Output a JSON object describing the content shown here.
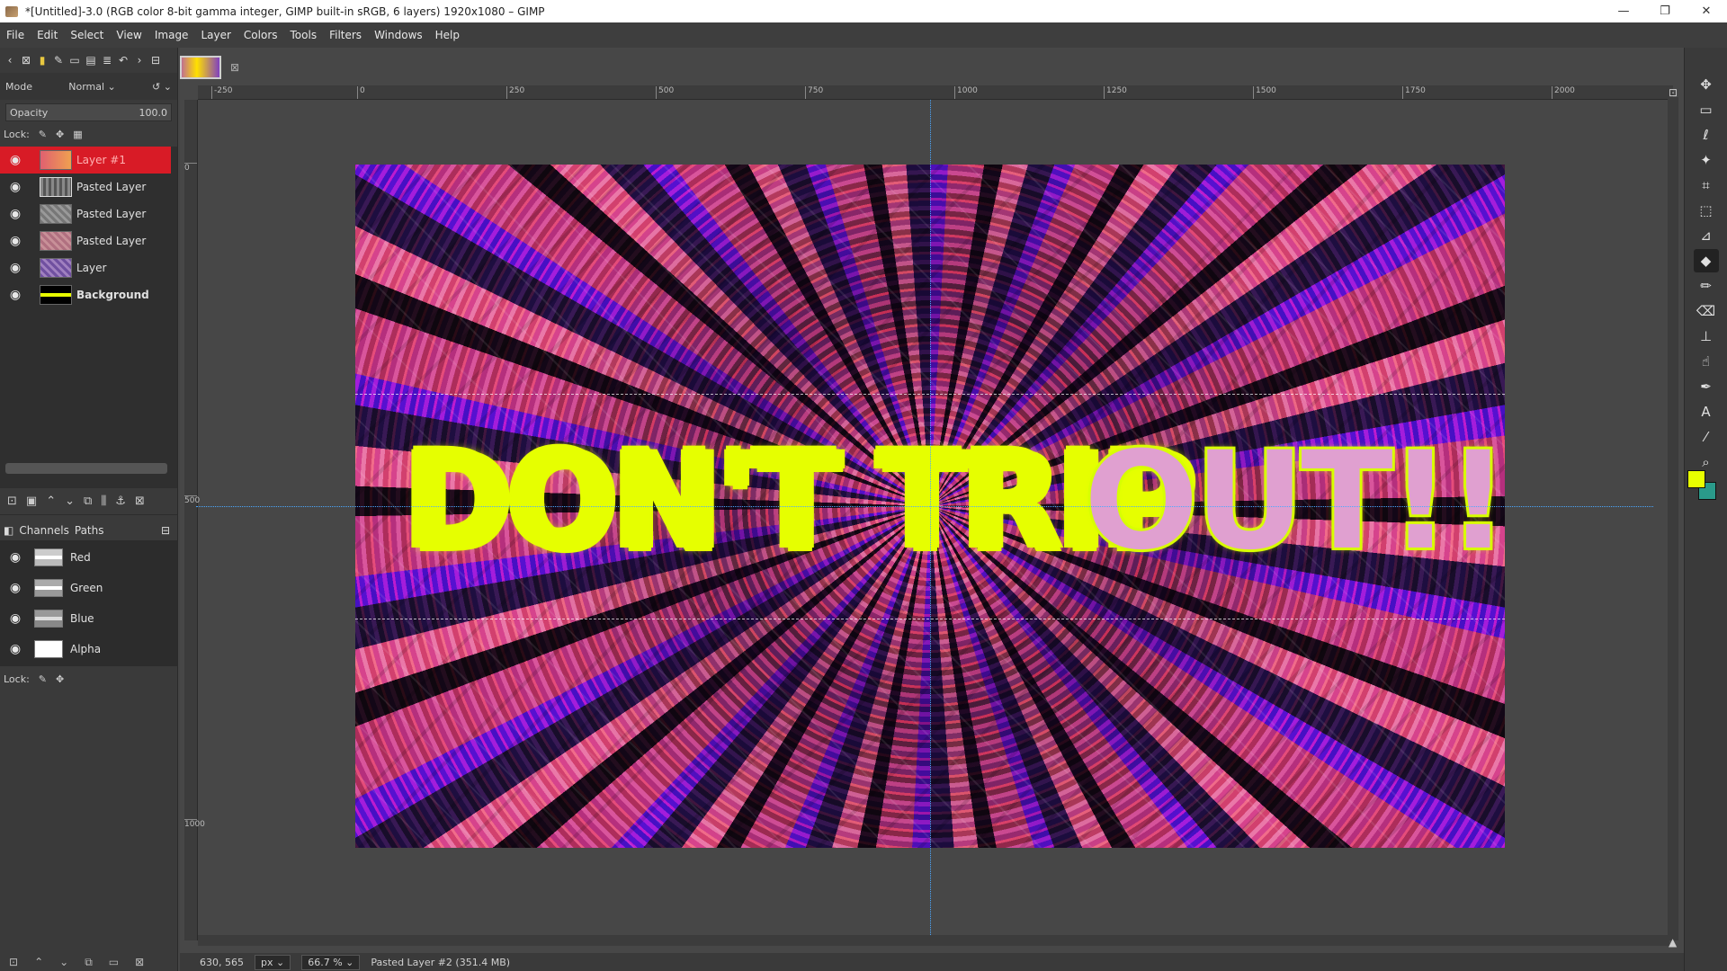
{
  "window": {
    "title": "*[Untitled]-3.0 (RGB color 8-bit gamma integer, GIMP built-in sRGB, 6 layers) 1920x1080 – GIMP",
    "minimize": "—",
    "maximize": "❐",
    "close": "✕"
  },
  "menu": [
    "File",
    "Edit",
    "Select",
    "View",
    "Image",
    "Layer",
    "Colors",
    "Tools",
    "Filters",
    "Windows",
    "Help"
  ],
  "layers_panel": {
    "mode_label": "Mode",
    "mode_value": "Normal",
    "opacity_label": "Opacity",
    "opacity_value": "100.0",
    "lock_label": "Lock:",
    "layers": [
      {
        "name": "Layer #1",
        "active": true
      },
      {
        "name": "Pasted Layer",
        "active": false
      },
      {
        "name": "Pasted Layer",
        "active": false
      },
      {
        "name": "Pasted Layer",
        "active": false
      },
      {
        "name": "Layer",
        "active": false
      },
      {
        "name": "Background",
        "active": false
      }
    ]
  },
  "channels_panel": {
    "tab_channels": "Channels",
    "tab_paths": "Paths",
    "channels": [
      "Red",
      "Green",
      "Blue",
      "Alpha"
    ],
    "lock_label": "Lock:"
  },
  "ruler": {
    "h_ticks": [
      "-250",
      "0",
      "250",
      "500",
      "750",
      "1000",
      "1250",
      "1500",
      "1750",
      "2000"
    ],
    "v_ticks": [
      "0",
      "500",
      "1000"
    ]
  },
  "canvas_text": {
    "left": "DON'T TRIP",
    "right": "OUT!!!"
  },
  "status": {
    "coords": "630, 565",
    "unit": "px",
    "zoom": "66.7 %",
    "message": "Pasted Layer #2 (351.4 MB)"
  },
  "colors": {
    "foreground": "#e8ff00",
    "background": "#2a9a8a",
    "active_layer": "#d81b26"
  }
}
